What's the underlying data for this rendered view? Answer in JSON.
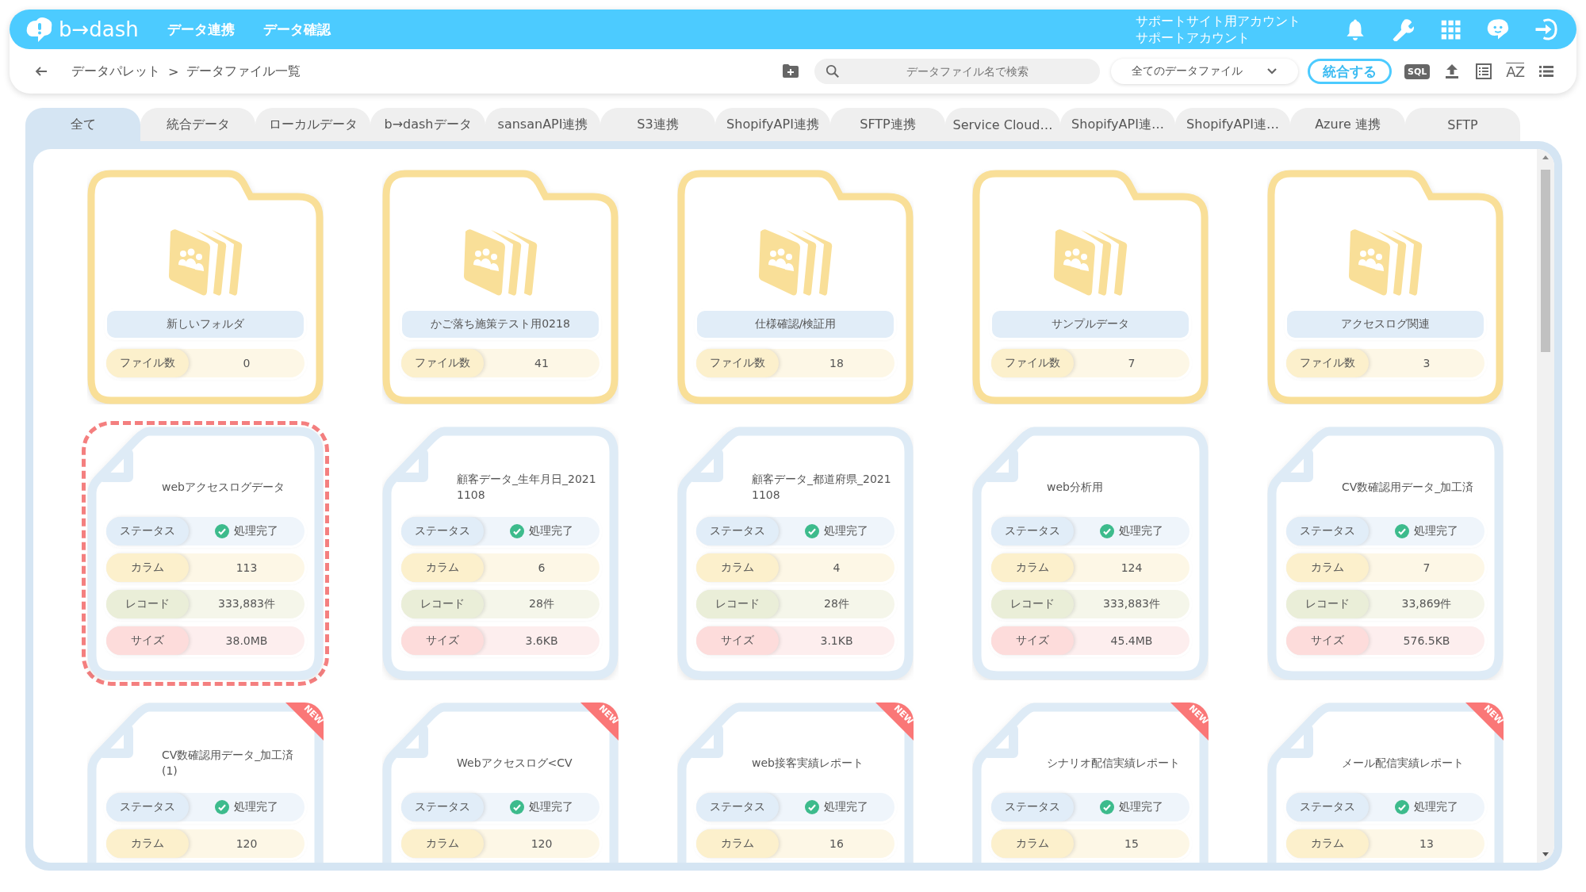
{
  "header": {
    "logo": "b→dash",
    "nav": [
      "データ連携",
      "データ確認"
    ],
    "account": [
      "サポートサイト用アカウント",
      "サポートアカウント"
    ]
  },
  "breadcrumb": {
    "items": [
      "データパレット",
      "データファイル一覧"
    ],
    "separator": ">"
  },
  "toolbar": {
    "search": {
      "placeholder": "データファイル名で検索"
    },
    "filter": "全てのデータファイル",
    "merge_button": "統合する",
    "sql_label": "SQL",
    "sort_label": "AZ"
  },
  "tabs": [
    {
      "label": "全て",
      "selected": true
    },
    {
      "label": "統合データ",
      "selected": false
    },
    {
      "label": "ローカルデータ",
      "selected": false
    },
    {
      "label": "b→dashデータ",
      "selected": false
    },
    {
      "label": "sansanAPI連携",
      "selected": false
    },
    {
      "label": "S3連携",
      "selected": false
    },
    {
      "label": "ShopifyAPI連携",
      "selected": false
    },
    {
      "label": "SFTP連携",
      "selected": false
    },
    {
      "label": "Service Cloud…",
      "selected": false
    },
    {
      "label": "ShopifyAPI連…",
      "selected": false
    },
    {
      "label": "ShopifyAPI連…",
      "selected": false
    },
    {
      "label": "Azure 連携",
      "selected": false
    },
    {
      "label": "SFTP",
      "selected": false
    }
  ],
  "folders": [
    {
      "name": "新しいフォルダ",
      "count_label": "ファイル数",
      "count": "0"
    },
    {
      "name": "かご落ち施策テスト用0218",
      "count_label": "ファイル数",
      "count": "41"
    },
    {
      "name": "仕様確認/検証用",
      "count_label": "ファイル数",
      "count": "18"
    },
    {
      "name": "サンプルデータ",
      "count_label": "ファイル数",
      "count": "7"
    },
    {
      "name": "アクセスログ関連",
      "count_label": "ファイル数",
      "count": "3"
    }
  ],
  "files": [
    {
      "name": "webアクセスログデータ",
      "selected": true,
      "stats": [
        {
          "kind": "status",
          "label": "ステータス",
          "value": "処理完了"
        },
        {
          "kind": "column",
          "label": "カラム",
          "value": "113"
        },
        {
          "kind": "record",
          "label": "レコード",
          "value": "333,883件"
        },
        {
          "kind": "size",
          "label": "サイズ",
          "value": "38.0MB"
        }
      ]
    },
    {
      "name": "顧客データ_生年月日_20211108",
      "selected": false,
      "stats": [
        {
          "kind": "status",
          "label": "ステータス",
          "value": "処理完了"
        },
        {
          "kind": "column",
          "label": "カラム",
          "value": "6"
        },
        {
          "kind": "record",
          "label": "レコード",
          "value": "28件"
        },
        {
          "kind": "size",
          "label": "サイズ",
          "value": "3.6KB"
        }
      ]
    },
    {
      "name": "顧客データ_都道府県_20211108",
      "selected": false,
      "stats": [
        {
          "kind": "status",
          "label": "ステータス",
          "value": "処理完了"
        },
        {
          "kind": "column",
          "label": "カラム",
          "value": "4"
        },
        {
          "kind": "record",
          "label": "レコード",
          "value": "28件"
        },
        {
          "kind": "size",
          "label": "サイズ",
          "value": "3.1KB"
        }
      ]
    },
    {
      "name": "web分析用",
      "selected": false,
      "stats": [
        {
          "kind": "status",
          "label": "ステータス",
          "value": "処理完了"
        },
        {
          "kind": "column",
          "label": "カラム",
          "value": "124"
        },
        {
          "kind": "record",
          "label": "レコード",
          "value": "333,883件"
        },
        {
          "kind": "size",
          "label": "サイズ",
          "value": "45.4MB"
        }
      ]
    },
    {
      "name": "CV数確認用データ_加工済",
      "selected": false,
      "stats": [
        {
          "kind": "status",
          "label": "ステータス",
          "value": "処理完了"
        },
        {
          "kind": "column",
          "label": "カラム",
          "value": "7"
        },
        {
          "kind": "record",
          "label": "レコード",
          "value": "33,869件"
        },
        {
          "kind": "size",
          "label": "サイズ",
          "value": "576.5KB"
        }
      ]
    },
    {
      "name": "CV数確認用データ_加工済(1)",
      "selected": false,
      "badge": "NEW",
      "stats": [
        {
          "kind": "status",
          "label": "ステータス",
          "value": "処理完了"
        },
        {
          "kind": "column",
          "label": "カラム",
          "value": "120"
        }
      ]
    },
    {
      "name": "Webアクセスログ<CV",
      "selected": false,
      "badge": "NEW",
      "stats": [
        {
          "kind": "status",
          "label": "ステータス",
          "value": "処理完了"
        },
        {
          "kind": "column",
          "label": "カラム",
          "value": "120"
        }
      ]
    },
    {
      "name": "web接客実績レポート",
      "selected": false,
      "badge": "NEW",
      "stats": [
        {
          "kind": "status",
          "label": "ステータス",
          "value": "処理完了"
        },
        {
          "kind": "column",
          "label": "カラム",
          "value": "16"
        }
      ]
    },
    {
      "name": "シナリオ配信実績レポート",
      "selected": false,
      "badge": "NEW",
      "stats": [
        {
          "kind": "status",
          "label": "ステータス",
          "value": "処理完了"
        },
        {
          "kind": "column",
          "label": "カラム",
          "value": "15"
        }
      ]
    },
    {
      "name": "メール配信実績レポート",
      "selected": false,
      "badge": "NEW",
      "stats": [
        {
          "kind": "status",
          "label": "ステータス",
          "value": "処理完了"
        },
        {
          "kind": "column",
          "label": "カラム",
          "value": "13"
        }
      ]
    }
  ]
}
